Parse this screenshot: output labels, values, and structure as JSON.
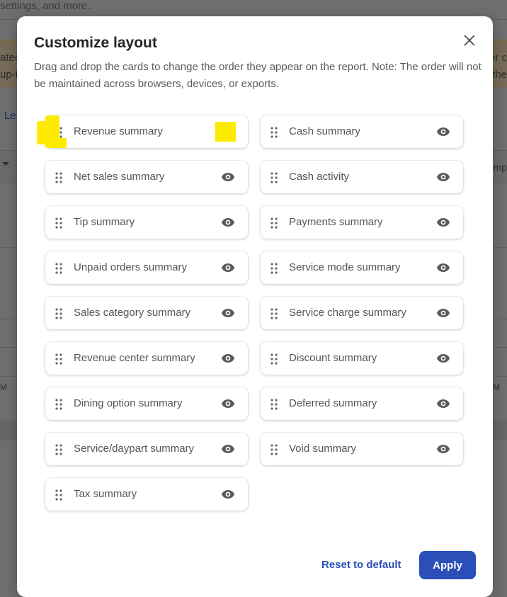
{
  "background": {
    "top_text": "settings, and more.",
    "alert_left_line1": "atec",
    "alert_left_line2": "up-t",
    "alert_right_line1": "er c",
    "alert_right_line2": "the",
    "link_fragment": "Le",
    "column_fragment": "Emp",
    "row_fragment_left": "M",
    "row_fragment_right": "M"
  },
  "modal": {
    "title": "Customize layout",
    "description": "Drag and drop the cards to change the order they appear on the report. Note: The order will not be maintained across browsers, devices, or exports.",
    "close_icon": "close-icon",
    "cards_left": [
      {
        "label": "Revenue summary",
        "visible": true
      },
      {
        "label": "Net sales summary",
        "visible": true
      },
      {
        "label": "Tip summary",
        "visible": true
      },
      {
        "label": "Unpaid orders summary",
        "visible": true
      },
      {
        "label": "Sales category summary",
        "visible": true
      },
      {
        "label": "Revenue center summary",
        "visible": true
      },
      {
        "label": "Dining option summary",
        "visible": true
      },
      {
        "label": "Service/daypart summary",
        "visible": true
      },
      {
        "label": "Tax summary",
        "visible": true
      }
    ],
    "cards_right": [
      {
        "label": "Cash summary",
        "visible": true
      },
      {
        "label": "Cash activity",
        "visible": true
      },
      {
        "label": "Payments summary",
        "visible": true
      },
      {
        "label": "Service mode summary",
        "visible": true
      },
      {
        "label": "Service charge summary",
        "visible": true
      },
      {
        "label": "Discount summary",
        "visible": true
      },
      {
        "label": "Deferred summary",
        "visible": true
      },
      {
        "label": "Void summary",
        "visible": true
      }
    ],
    "reset_label": "Reset to default",
    "apply_label": "Apply"
  },
  "colors": {
    "primary": "#2b4fb8",
    "link": "#2b4fb5",
    "highlight": "#ffeb00",
    "overlay": "#6f6f6f"
  }
}
